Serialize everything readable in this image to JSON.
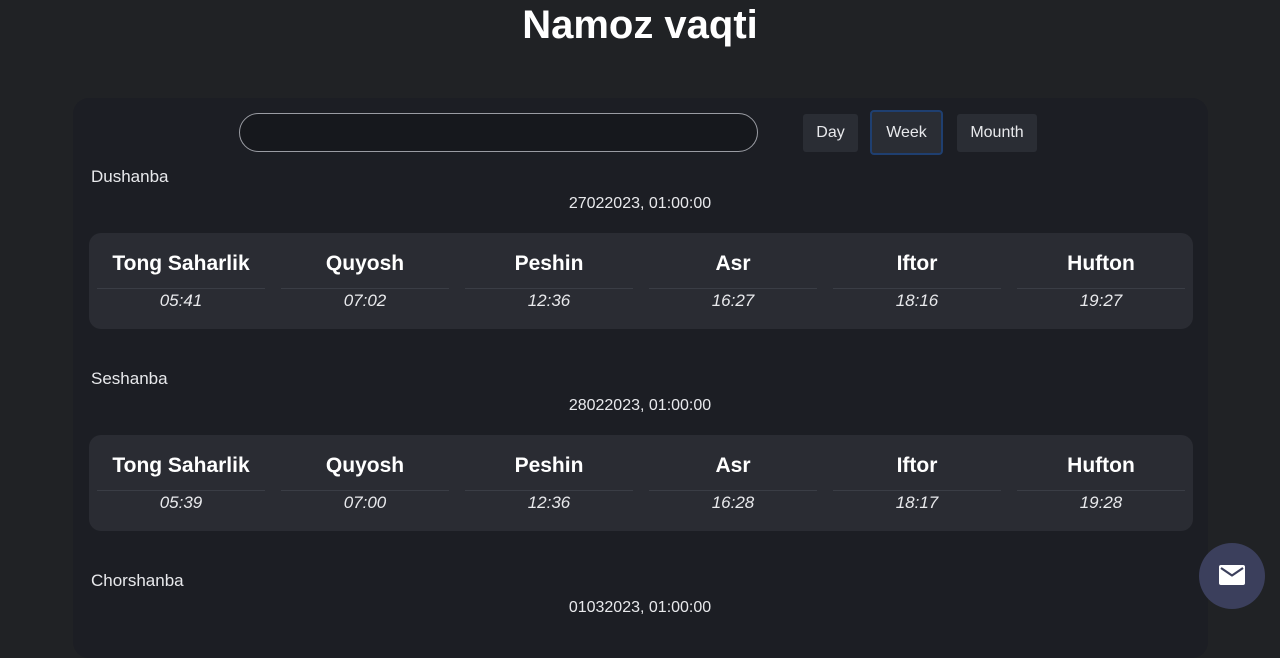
{
  "title": "Namoz vaqti",
  "search": {
    "value": "",
    "placeholder": ""
  },
  "view_buttons": {
    "day": "Day",
    "week": "Week",
    "month": "Mounth"
  },
  "prayer_names": [
    "Tong Saharlik",
    "Quyosh",
    "Peshin",
    "Asr",
    "Iftor",
    "Hufton"
  ],
  "days": [
    {
      "weekday": "Dushanba",
      "date": "27022023, 01:00:00",
      "times": [
        "05:41",
        "07:02",
        "12:36",
        "16:27",
        "18:16",
        "19:27"
      ]
    },
    {
      "weekday": "Seshanba",
      "date": "28022023, 01:00:00",
      "times": [
        "05:39",
        "07:00",
        "12:36",
        "16:28",
        "18:17",
        "19:28"
      ]
    },
    {
      "weekday": "Chorshanba",
      "date": "01032023, 01:00:00"
    }
  ],
  "icons": {
    "fab": "mail-icon"
  },
  "colors": {
    "background": "#202225",
    "panel": "#1c1e24",
    "card": "#2a2c33",
    "fab": "#3b3f5c",
    "week_border": "#1f3f70"
  }
}
